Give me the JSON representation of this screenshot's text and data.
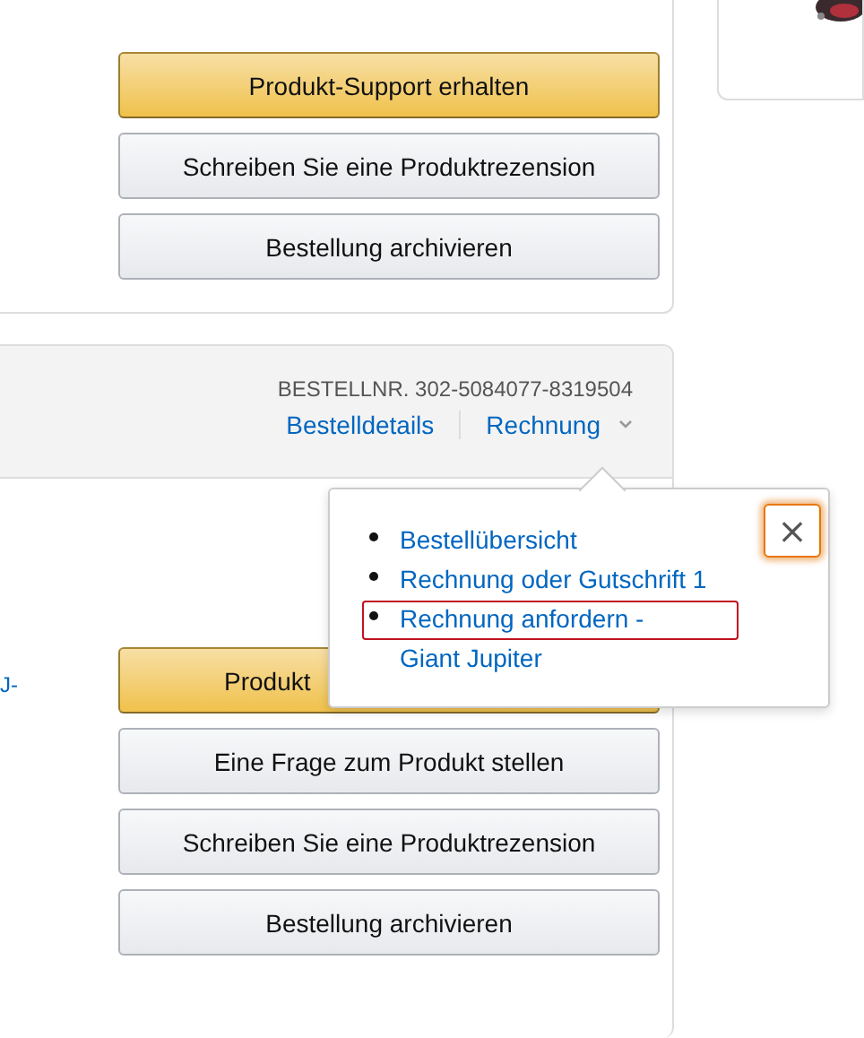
{
  "order_cards": [
    {
      "buttons": [
        {
          "label": "Produkt-Support erhalten",
          "kind": "primary"
        },
        {
          "label": "Schreiben Sie eine Produktrezension",
          "kind": "secondary"
        },
        {
          "label": "Bestellung archivieren",
          "kind": "secondary"
        }
      ]
    },
    {
      "order_number": "BESTELLNR. 302-5084077-8319504",
      "links": [
        "Bestelldetails",
        "Rechnung"
      ],
      "side_link": "J-",
      "buttons": [
        {
          "label": "Produkt",
          "kind": "primary_covered"
        },
        {
          "label": "Eine Frage zum Produkt stellen",
          "kind": "secondary"
        },
        {
          "label": "Schreiben Sie eine Produktrezension",
          "kind": "secondary"
        },
        {
          "label": "Bestellung archivieren",
          "kind": "secondary"
        }
      ]
    }
  ],
  "popover": {
    "close": "×",
    "items": [
      {
        "label": "Bestellübersicht",
        "highlighted": false
      },
      {
        "label": "Rechnung oder Gutschrift 1",
        "highlighted": false
      },
      {
        "label": "Rechnung anfordern -\nGiant Jupiter",
        "highlighted": true
      }
    ]
  }
}
